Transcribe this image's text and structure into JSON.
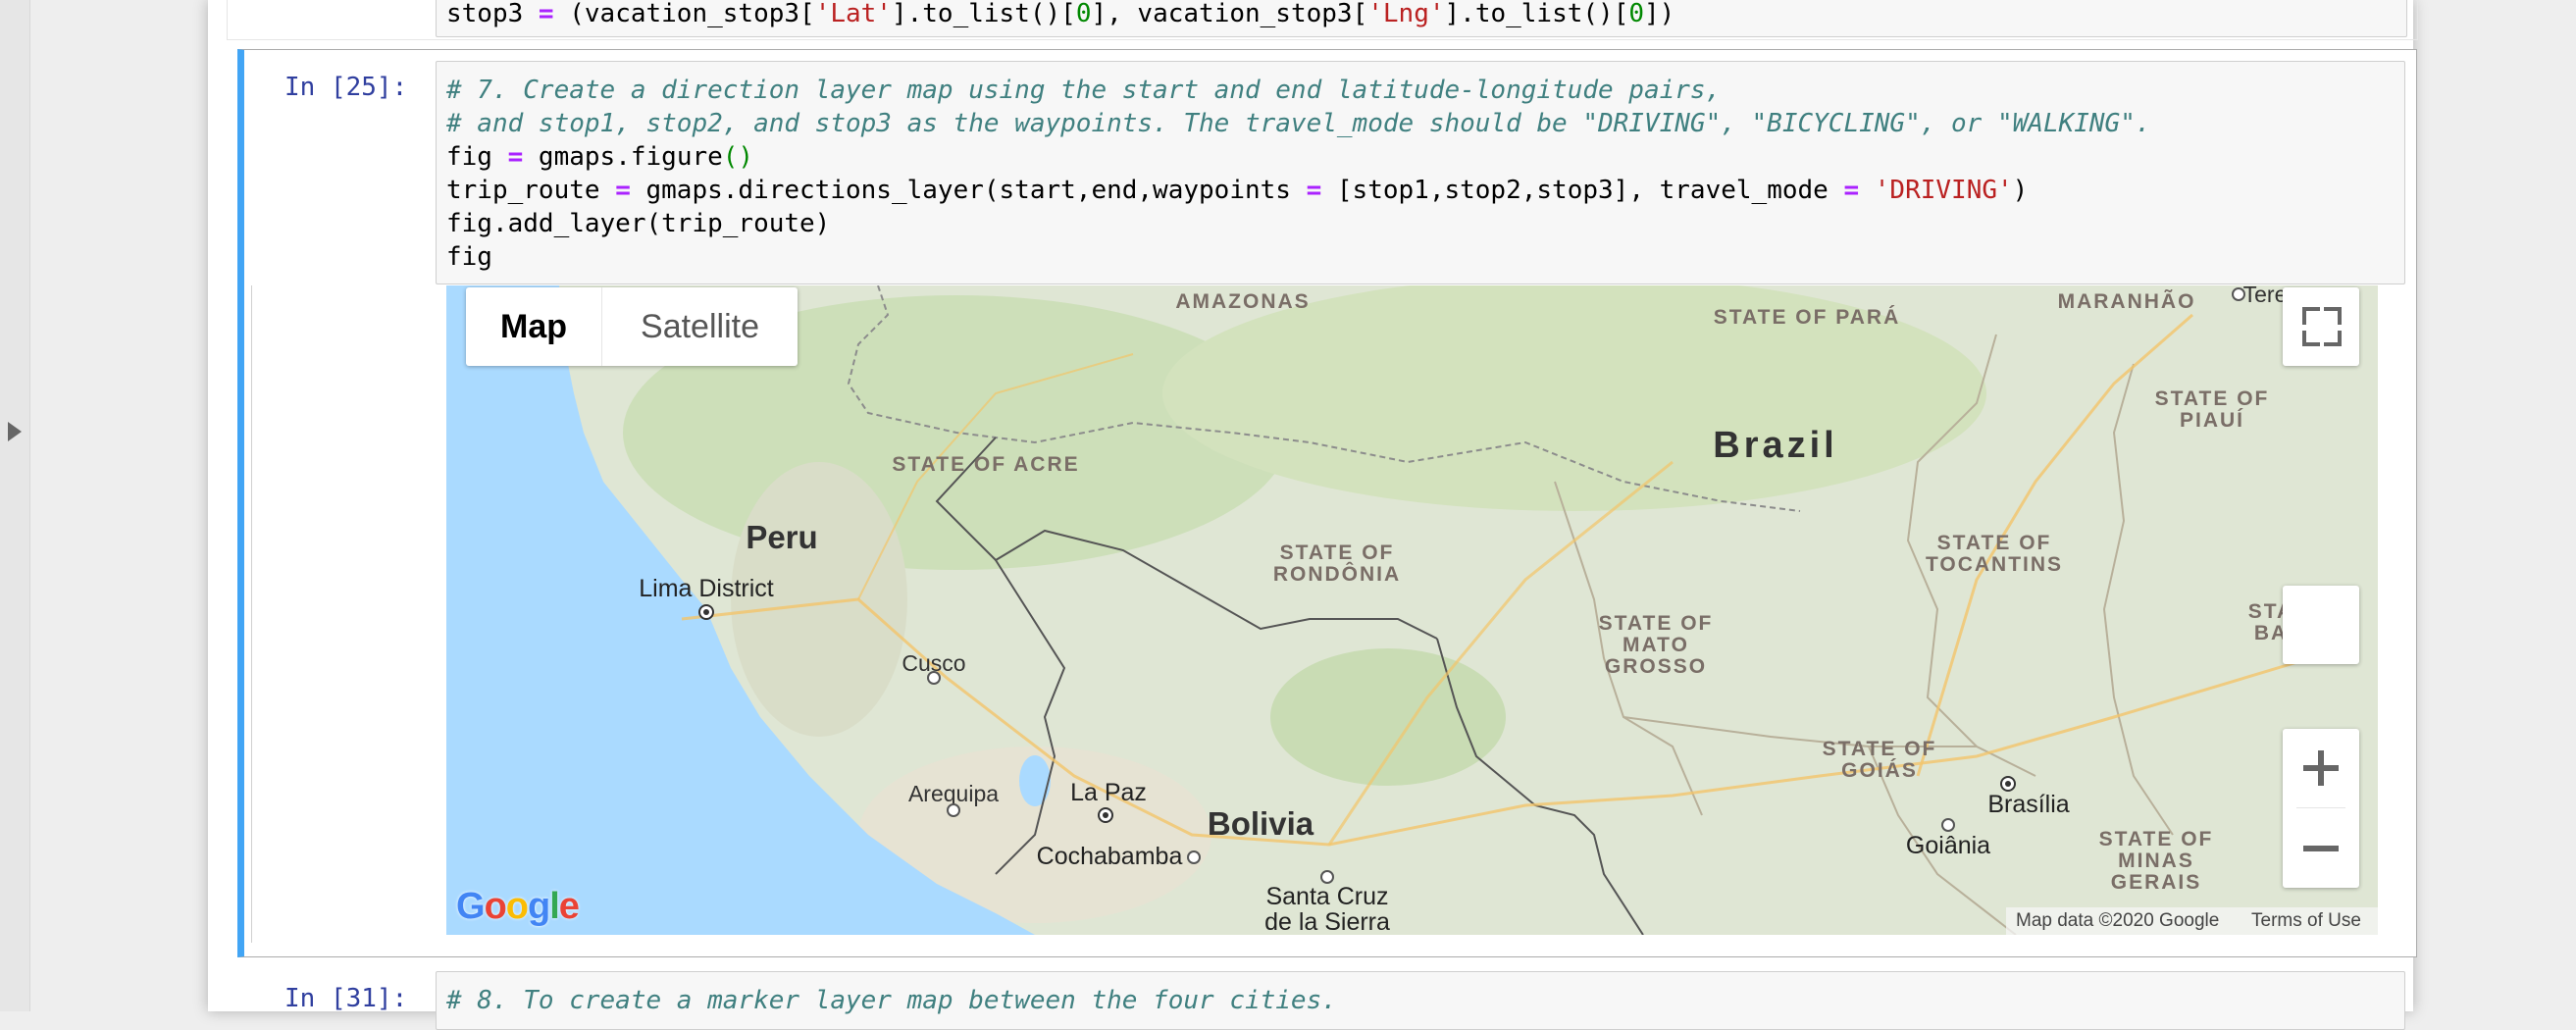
{
  "prev_cell": {
    "code": {
      "p1": "stop3 ",
      "p2": "=",
      "p3": " (vacation_stop3[",
      "p4": "'Lat'",
      "p5": "].to_list()[",
      "p6": "0",
      "p7": "], vacation_stop3[",
      "p8": "'Lng'",
      "p9": "].to_list()[",
      "p10": "0",
      "p11": "])"
    }
  },
  "cell_25": {
    "prompt": "In [25]:",
    "lines": {
      "comment1": "# 7. Create a direction layer map using the start and end latitude-longitude pairs,",
      "comment2": "# and stop1, stop2, and stop3 as the waypoints. The travel_mode should be \"DRIVING\", \"BICYCLING\", or \"WALKING\".",
      "l3_a": "fig ",
      "l3_op": "=",
      "l3_b": " gmaps.figure",
      "l3_paren": "()",
      "l4_a": "trip_route ",
      "l4_op": "=",
      "l4_b": " gmaps.directions_layer(start,end,waypoints ",
      "l4_op2": "=",
      "l4_c": " [stop1,stop2,stop3], travel_mode ",
      "l4_op3": "=",
      "l4_str": "'DRIVING'",
      "l4_close": ")",
      "l5": "fig.add_layer(trip_route)",
      "l6": "fig"
    }
  },
  "map": {
    "type_buttons": {
      "map": "Map",
      "satellite": "Satellite"
    },
    "countries": {
      "brazil": "Brazil",
      "peru": "Peru",
      "bolivia": "Bolivia"
    },
    "states": {
      "amazonas": "AMAZONAS",
      "para": "STATE OF PARÁ",
      "maranhao": "MARANHÃO",
      "piaui": "STATE OF\nPIAUÍ",
      "acre": "STATE OF ACRE",
      "rondonia": "STATE OF\nRONDÔNIA",
      "tocantins": "STATE OF\nTOCANTINS",
      "mato_grosso": "STATE OF\nMATO\nGROSSO",
      "goias": "STATE OF\nGOIÁS",
      "minas_gerais": "STATE OF\nMINAS\nGERAIS",
      "bahia_partial": "STA\nBA"
    },
    "cities": {
      "lima": "Lima District",
      "cusco": "Cusco",
      "arequipa": "Arequipa",
      "la_paz": "La Paz",
      "cochabamba": "Cochabamba",
      "santa_cruz": "Santa Cruz\nde la Sierra",
      "brasilia": "Brasília",
      "goiania": "Goiânia",
      "teresina_partial": "Tere"
    },
    "footer": {
      "data": "Map data ©2020 Google",
      "terms": "Terms of Use"
    },
    "logo": "Google",
    "colors": {
      "water": "#aadaff",
      "land": "#dfe6d4",
      "border": "#8c8c8c"
    }
  },
  "cell_31": {
    "prompt": "In [31]:",
    "comment": "# 8. To create a marker layer map between the four cities."
  }
}
